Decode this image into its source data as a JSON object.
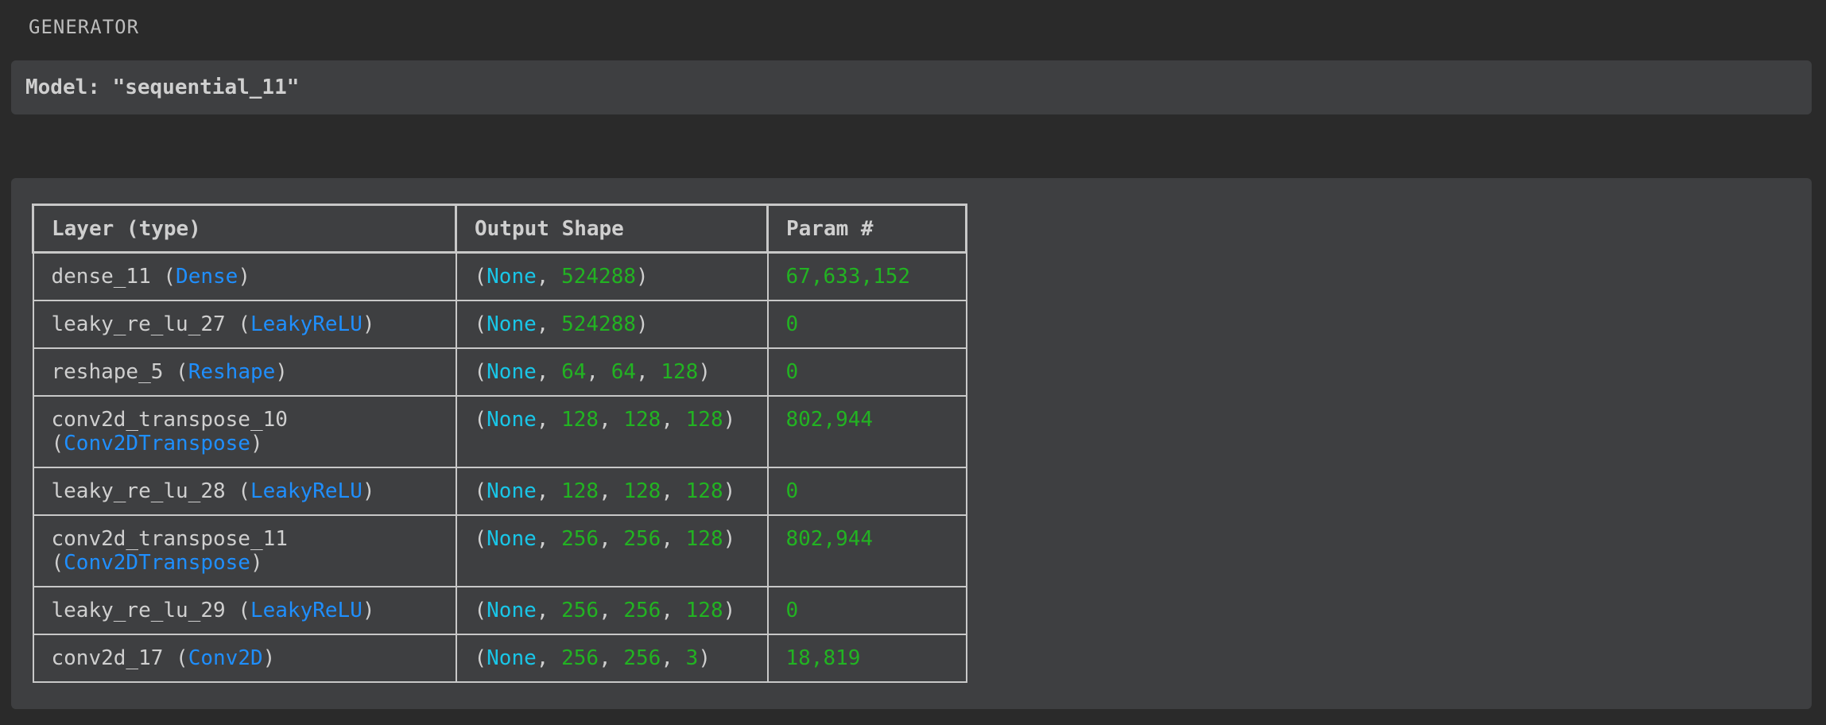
{
  "header": {
    "label": "GENERATOR"
  },
  "model": {
    "title": "Model: \"sequential_11\""
  },
  "summary": {
    "columns": [
      "Layer (type)",
      "Output Shape",
      "Param #"
    ],
    "rows": [
      {
        "name": "dense_11",
        "type": "Dense",
        "shape": [
          "None",
          "524288"
        ],
        "params": "67,633,152"
      },
      {
        "name": "leaky_re_lu_27",
        "type": "LeakyReLU",
        "shape": [
          "None",
          "524288"
        ],
        "params": "0"
      },
      {
        "name": "reshape_5",
        "type": "Reshape",
        "shape": [
          "None",
          "64",
          "64",
          "128"
        ],
        "params": "0"
      },
      {
        "name": "conv2d_transpose_10",
        "type": "Conv2DTranspose",
        "shape": [
          "None",
          "128",
          "128",
          "128"
        ],
        "params": "802,944"
      },
      {
        "name": "leaky_re_lu_28",
        "type": "LeakyReLU",
        "shape": [
          "None",
          "128",
          "128",
          "128"
        ],
        "params": "0"
      },
      {
        "name": "conv2d_transpose_11",
        "type": "Conv2DTranspose",
        "shape": [
          "None",
          "256",
          "256",
          "128"
        ],
        "params": "802,944"
      },
      {
        "name": "leaky_re_lu_29",
        "type": "LeakyReLU",
        "shape": [
          "None",
          "256",
          "256",
          "128"
        ],
        "params": "0"
      },
      {
        "name": "conv2d_17",
        "type": "Conv2D",
        "shape": [
          "None",
          "256",
          "256",
          "3"
        ],
        "params": "18,819"
      }
    ]
  },
  "colors": {
    "background": "#2a2a2a",
    "panel": "#3e3f41",
    "layer_type": "#1f8fff",
    "none_keyword": "#19c6e8",
    "number": "#22b322"
  }
}
